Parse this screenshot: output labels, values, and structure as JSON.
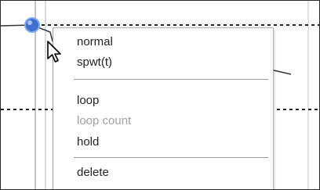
{
  "context_menu": {
    "groups": [
      {
        "items": [
          {
            "label": "normal",
            "enabled": true
          },
          {
            "label": "spwt(t)",
            "enabled": true
          }
        ]
      },
      {
        "items": [
          {
            "label": "loop",
            "enabled": true
          },
          {
            "label": "loop count",
            "enabled": false
          },
          {
            "label": "hold",
            "enabled": true
          }
        ]
      },
      {
        "items": [
          {
            "label": "delete",
            "enabled": true
          }
        ]
      }
    ]
  },
  "cursor": {
    "icon": "arrow-pointer-icon"
  },
  "colors": {
    "curve": "#333333",
    "grid": "#b4b4b4",
    "breakpoint_handle": "#3f6fd0",
    "disabled_text": "#a0a0a0"
  }
}
